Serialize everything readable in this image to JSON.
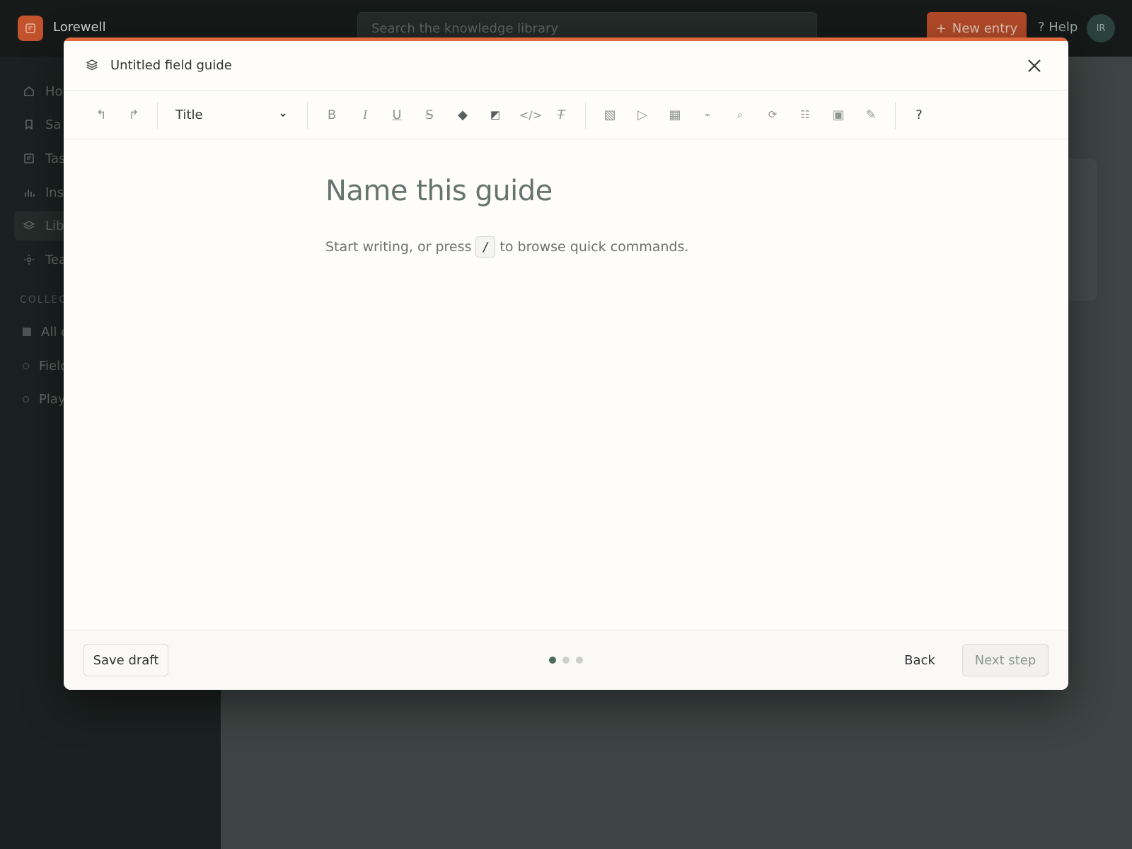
{
  "app": {
    "name": "Lorewell",
    "search_placeholder": "Search the knowledge library",
    "new_entry_label": "New entry",
    "help_label": "? Help",
    "avatar_initials": "IR"
  },
  "sidebar": {
    "items": [
      {
        "label": "Ho",
        "icon": "home-icon"
      },
      {
        "label": "Sa",
        "icon": "bookmark-icon"
      },
      {
        "label": "Tas",
        "icon": "tasks-icon"
      },
      {
        "label": "Ins",
        "icon": "chart-icon"
      },
      {
        "label": "Lib",
        "icon": "layers-icon"
      },
      {
        "label": "Tea",
        "icon": "team-icon"
      }
    ],
    "collections_heading": "COLLEC",
    "collections": [
      {
        "label": "All e"
      },
      {
        "label": "Field"
      },
      {
        "label": "Playl"
      }
    ]
  },
  "modal": {
    "title": "Untitled field guide",
    "accent_color": "#e0683d",
    "toolbar": {
      "style_select_value": "Title",
      "undo_glyph": "↰",
      "redo_glyph": "↱",
      "bold_glyph": "B",
      "italic_glyph": "I",
      "underline_glyph": "U",
      "strike_glyph": "S",
      "highlight_glyph": "◆",
      "color_glyph": "◩",
      "code_glyph": "</>",
      "clear_format_glyph": "T",
      "image_glyph": "▧",
      "video_glyph": "▷",
      "table_glyph": "▦",
      "link_glyph": "⌁",
      "search_glyph": "⌕",
      "loop_glyph": "⟳",
      "list_glyph": "☷",
      "embed_glyph": "▣",
      "pen_glyph": "✎",
      "help_glyph": "?"
    },
    "editor": {
      "title_placeholder": "Name this guide",
      "hint_before": "Start writing, or press",
      "hint_key": "/",
      "hint_after": "to browse quick commands."
    },
    "footer": {
      "save_draft_label": "Save draft",
      "back_label": "Back",
      "next_label": "Next step",
      "steps_total": 3,
      "current_step": 1
    }
  }
}
